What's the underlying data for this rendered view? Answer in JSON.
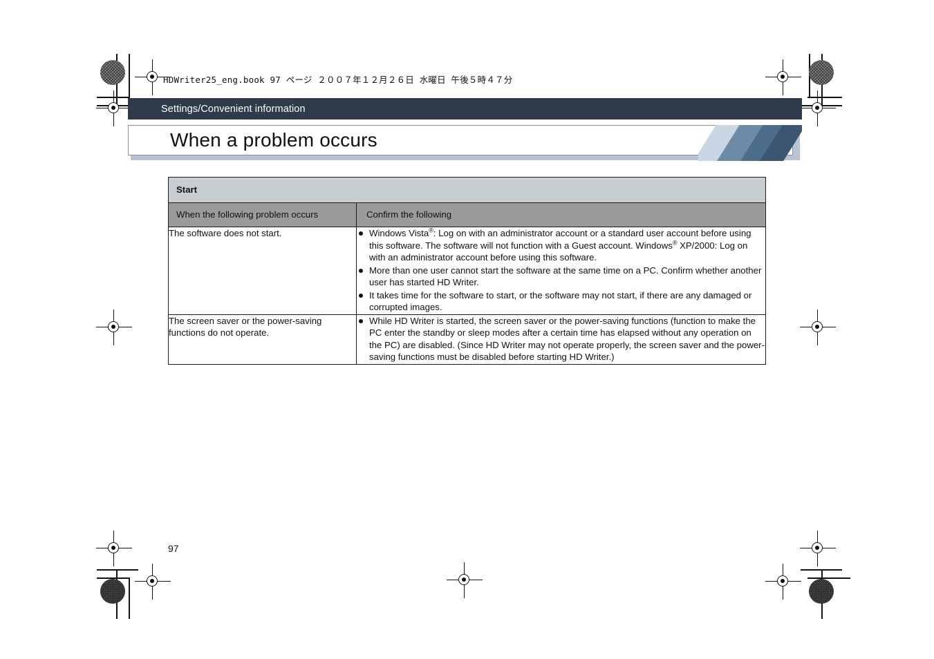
{
  "document": {
    "file_info": "HDWriter25_eng.book  97 ページ  ２００７年１２月２６日  水曜日  午後５時４７分",
    "page_number": "97",
    "section_label": "Settings/Convenient information",
    "title": "When a problem occurs"
  },
  "colors": {
    "section_bar": "#2e3b4a",
    "title_border": "#7f93aa",
    "title_shadow": "#b9c4d2",
    "start_row_bg": "#c6ced1",
    "col_header_bg": "#9b9b9b",
    "deco_light": "#c9d6e4",
    "deco_mid": "#6d8aa6",
    "deco_dark": "#4c6c8c",
    "deco_darkest": "#3c5570",
    "text": "#111111"
  },
  "table": {
    "group_header": "Start",
    "columns": [
      "When the following problem occurs",
      "Confirm the following"
    ],
    "rows": [
      {
        "problem": "The software does not start.",
        "bullets": [
          {
            "segments": [
              {
                "text": "Windows Vista"
              },
              {
                "text": "®",
                "sup": true
              },
              {
                "text": ": Log on with an administrator account or a standard user account before using this software. The software will not function with a Guest account. Windows"
              },
              {
                "text": "®",
                "sup": true
              },
              {
                "text": " XP/2000: Log on with an administrator account before using this software."
              }
            ]
          },
          {
            "segments": [
              {
                "text": "More than one user cannot start the software at the same time on a PC. Confirm whether another user has started HD Writer."
              }
            ]
          },
          {
            "segments": [
              {
                "text": "It takes time for the software to start, or the software may not start, if there are any damaged or corrupted images."
              }
            ]
          }
        ]
      },
      {
        "problem": "The screen saver or the power-saving functions do not operate.",
        "bullets": [
          {
            "segments": [
              {
                "text": "While HD Writer is started, the screen saver or the power-saving functions (function to make the PC enter the standby or sleep modes after a certain time has elapsed without any operation on the PC) are disabled. (Since HD Writer may not operate properly, the screen saver and the power-saving functions must be disabled before starting HD Writer.)"
              }
            ]
          }
        ]
      }
    ]
  },
  "printer_marks": {
    "registration_mark_name": "registration-target-mark",
    "density_patch_name": "density-patch",
    "crop_mark_name": "crop-mark"
  }
}
